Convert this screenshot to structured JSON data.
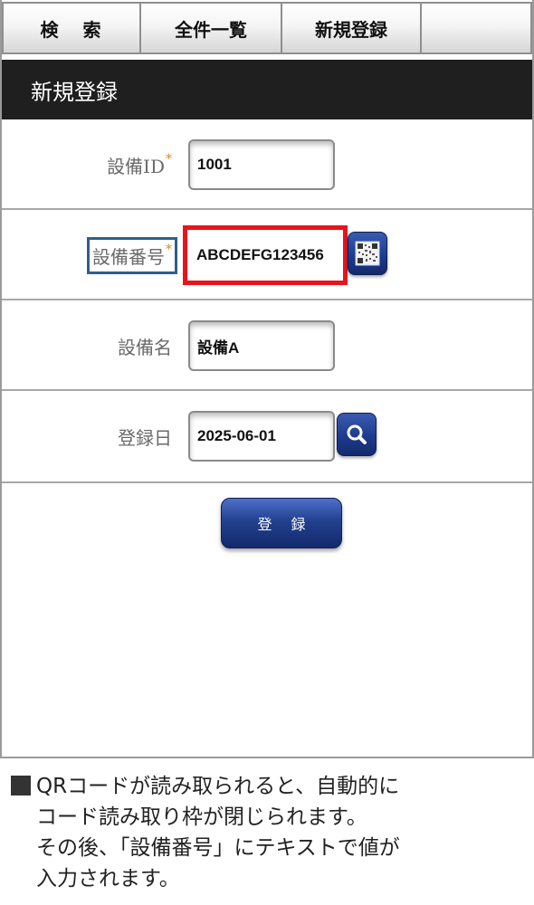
{
  "tabs": {
    "search": "検 索",
    "list_all": "全件一覧",
    "new_registration": "新規登録"
  },
  "header": {
    "title": "新規登録"
  },
  "form": {
    "equipment_id": {
      "label": "設備ID",
      "required_mark": "*",
      "value": "1001"
    },
    "equipment_number": {
      "label": "設備番号",
      "required_mark": "*",
      "value": "ABCDEFG123456"
    },
    "equipment_name": {
      "label": "設備名",
      "value": "設備A"
    },
    "registration_date": {
      "label": "登録日",
      "value": "2025-06-01"
    },
    "submit_label": "登 録"
  },
  "icons": {
    "qr_scan": "qr-code-icon",
    "date_search": "search-icon"
  },
  "caption": {
    "line1": "QRコードが読み取られると、自動的に",
    "line2": "コード読み取り枠が閉じられます。",
    "line3": "その後、「設備番号」にテキストで値が",
    "line4": "入力されます。"
  },
  "colors": {
    "header_bg": "#1f1f1f",
    "button_blue": "#1d3c8f",
    "highlight_red": "#e8141c",
    "highlight_blue": "#2f5f8a",
    "required_orange": "#d28a2a"
  }
}
